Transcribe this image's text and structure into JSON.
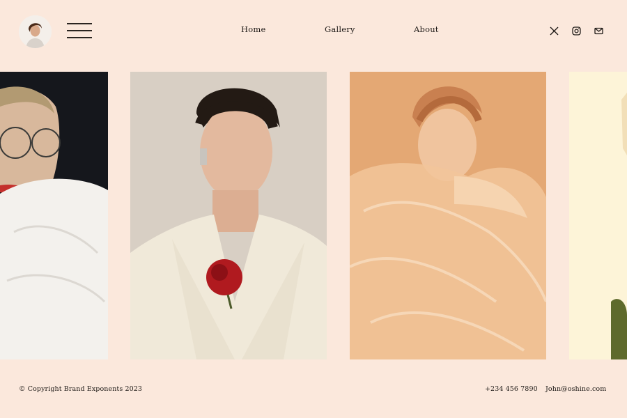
{
  "header": {
    "nav": [
      {
        "label": "Home"
      },
      {
        "label": "Gallery"
      },
      {
        "label": "About"
      }
    ],
    "social_icons": [
      "x-twitter-icon",
      "instagram-icon",
      "mail-icon"
    ]
  },
  "gallery": {
    "photos": [
      {
        "subject": "woman-with-round-glasses-white-fabric"
      },
      {
        "subject": "woman-cream-blazer-red-rose"
      },
      {
        "subject": "woman-peach-tulle-gown"
      },
      {
        "subject": "woman-partial-yellow-background"
      }
    ]
  },
  "footer": {
    "copyright": "© Copyright Brand Exponents 2023",
    "phone": "+234 456 7890",
    "email": "John@oshine.com"
  },
  "colors": {
    "background": "#fbe8dc",
    "text": "#1e1a17"
  }
}
